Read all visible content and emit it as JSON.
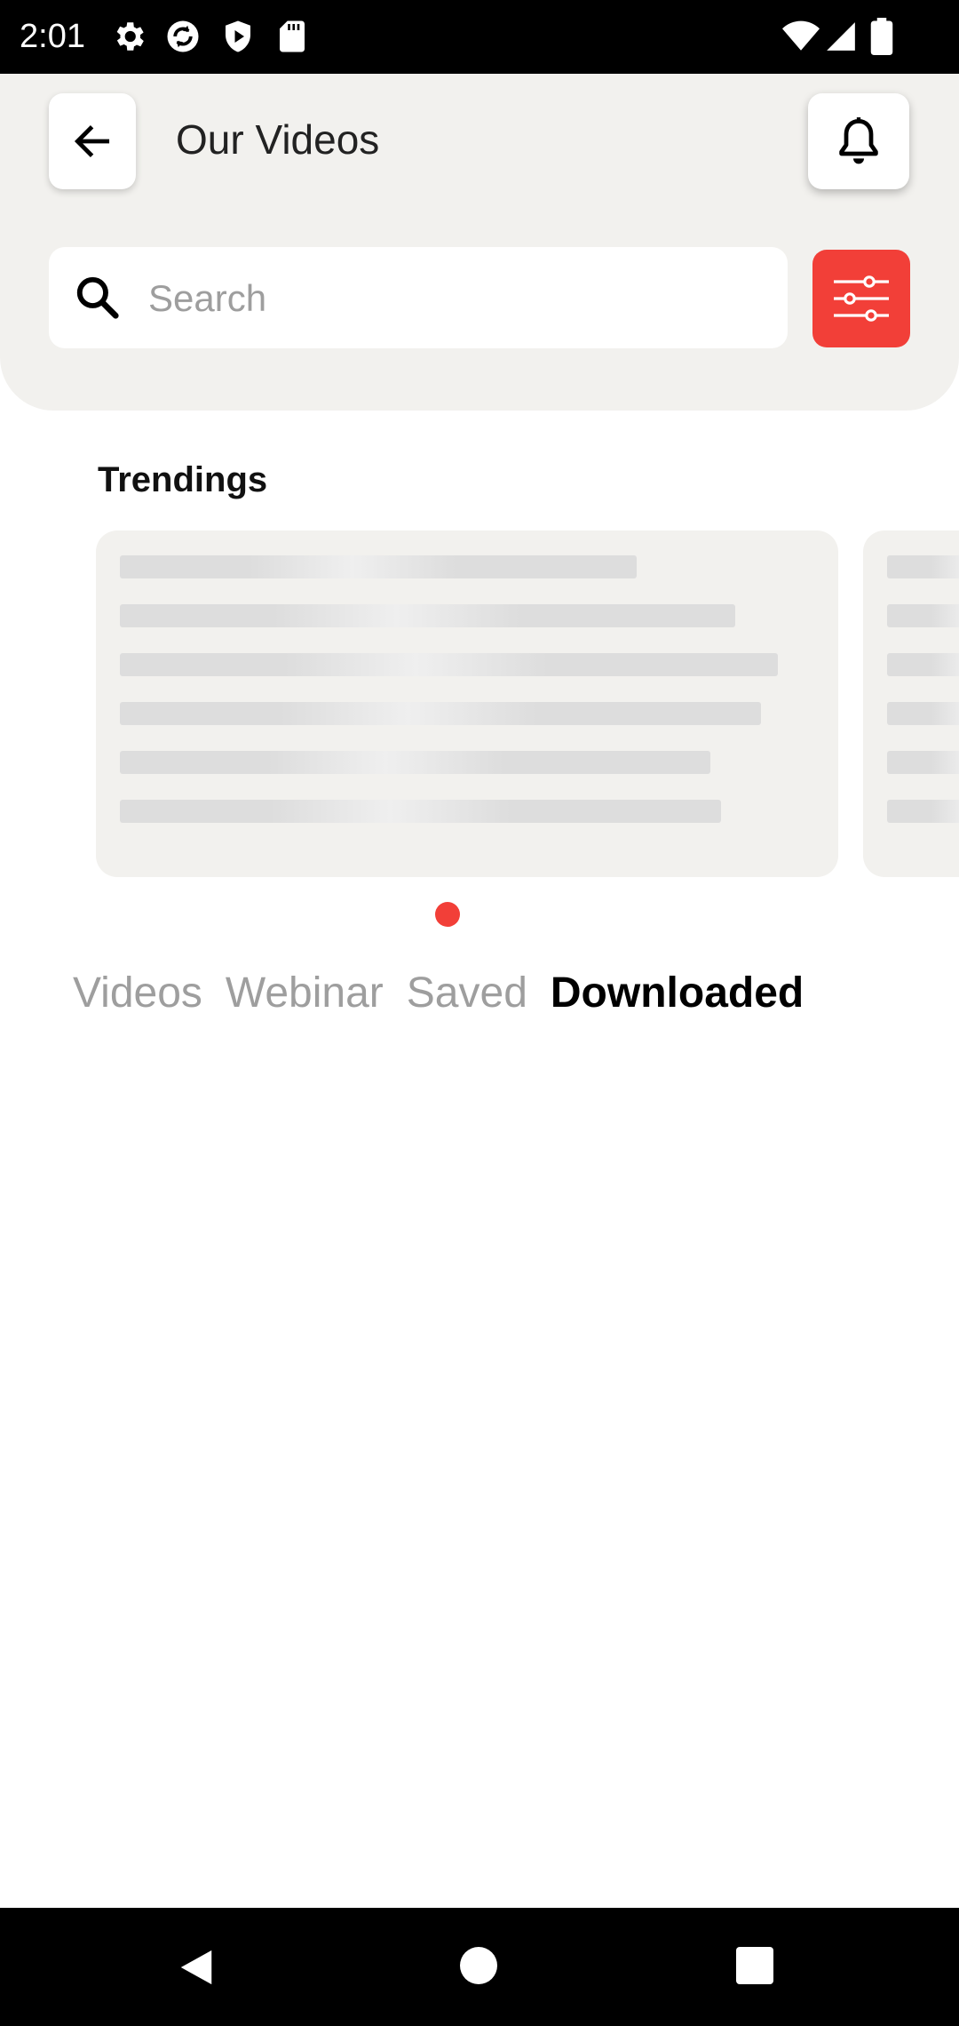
{
  "status_bar": {
    "time": "2:01",
    "left_icons": [
      "gear-icon",
      "sync-icon",
      "shield-play-icon",
      "sd-card-icon"
    ],
    "right_icons": [
      "wifi-icon",
      "cell-signal-icon",
      "battery-icon"
    ]
  },
  "header": {
    "title": "Our Videos",
    "back_icon": "arrow-left-icon",
    "notification_icon": "bell-icon"
  },
  "search": {
    "placeholder": "Search",
    "value": "",
    "filter_icon": "sliders-icon"
  },
  "colors": {
    "accent": "#f23f38",
    "header_bg": "#f2f1ee",
    "inactive_tab": "#9e9e9e"
  },
  "trending": {
    "title": "Trendings",
    "cards_loading": true,
    "active_page": 1,
    "page_count": 1
  },
  "tabs": [
    {
      "label": "Videos",
      "active": false
    },
    {
      "label": "Webinar",
      "active": false
    },
    {
      "label": "Saved",
      "active": false
    },
    {
      "label": "Downloaded",
      "active": true
    }
  ],
  "nav_bar": {
    "icons": [
      "back-triangle-icon",
      "home-circle-icon",
      "recents-square-icon"
    ]
  }
}
